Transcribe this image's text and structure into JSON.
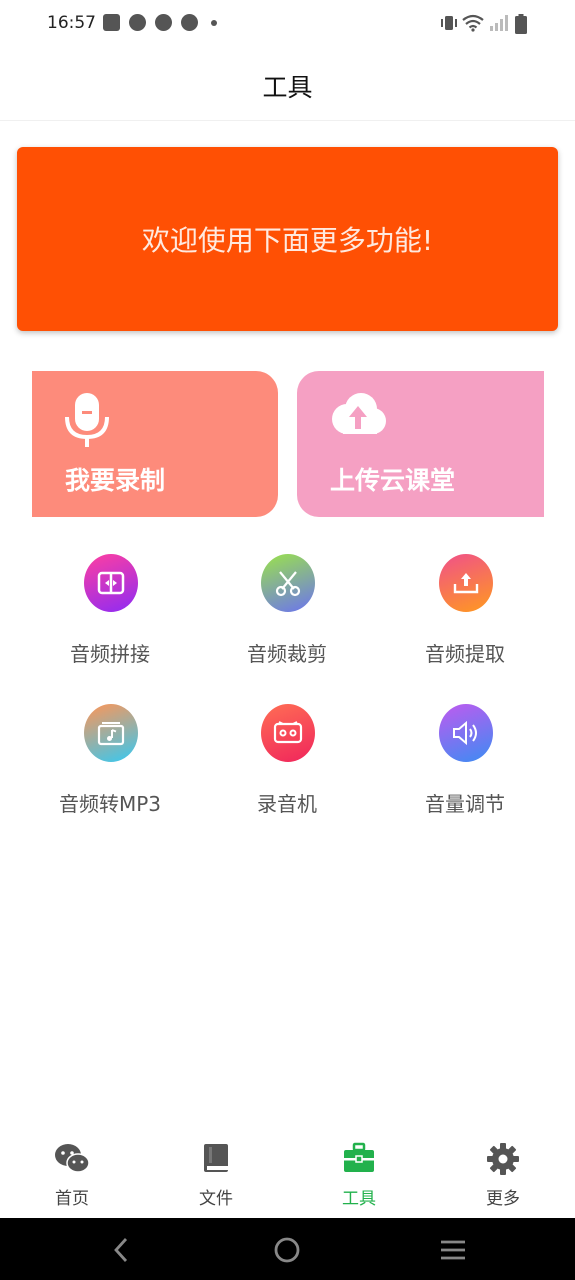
{
  "status_bar": {
    "time": "16:57",
    "icons": [
      "notification-box-icon",
      "notification-circle-icon",
      "notification-circle-icon",
      "notification-circle-icon",
      "notification-dot-icon",
      "vibrate-icon",
      "wifi-icon",
      "signal-icon",
      "battery-icon"
    ]
  },
  "header": {
    "title": "工具"
  },
  "banner": {
    "text": "欢迎使用下面更多功能!",
    "color": "#ff5004"
  },
  "cards": [
    {
      "label": "我要录制",
      "icon": "microphone-icon",
      "color": "#fd8b7b"
    },
    {
      "label": "上传云课堂",
      "icon": "cloud-upload-icon",
      "color": "#f5a0c3"
    }
  ],
  "tools": [
    {
      "label": "音频拼接",
      "icon": "audio-join-icon"
    },
    {
      "label": "音频裁剪",
      "icon": "scissors-icon"
    },
    {
      "label": "音频提取",
      "icon": "extract-upload-icon"
    },
    {
      "label": "音频转MP3",
      "icon": "music-folder-icon"
    },
    {
      "label": "录音机",
      "icon": "cassette-icon"
    },
    {
      "label": "音量调节",
      "icon": "speaker-volume-icon"
    }
  ],
  "tabs": [
    {
      "label": "首页",
      "icon": "wechat-icon",
      "active": false
    },
    {
      "label": "文件",
      "icon": "book-icon",
      "active": false
    },
    {
      "label": "工具",
      "icon": "toolbox-icon",
      "active": true
    },
    {
      "label": "更多",
      "icon": "gear-icon",
      "active": false
    }
  ],
  "colors": {
    "accent_green": "#22b14c"
  },
  "nav": {
    "buttons": [
      "back-icon",
      "home-icon",
      "menu-icon"
    ]
  }
}
